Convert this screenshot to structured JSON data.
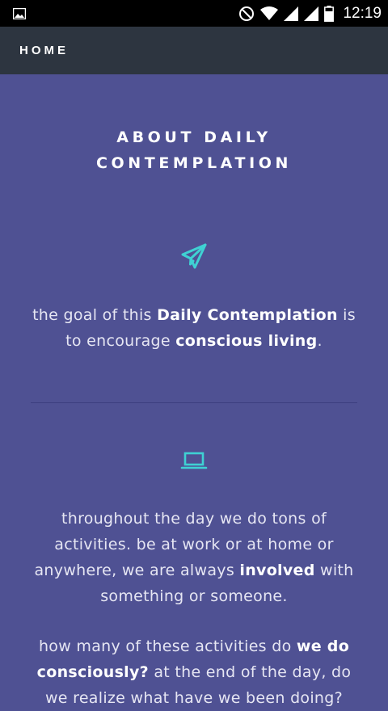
{
  "status_bar": {
    "time": "12:19",
    "icons": [
      "gallery-icon",
      "do-not-disturb-icon",
      "wifi-icon",
      "signal-icon",
      "signal-icon-2",
      "battery-icon"
    ]
  },
  "nav": {
    "home_label": "HOME"
  },
  "page": {
    "title_line1": "ABOUT DAILY",
    "title_line2": "CONTEMPLATION"
  },
  "sections": [
    {
      "icon": "paper-plane-icon",
      "p1": {
        "t1": "the goal of this ",
        "b1": "Daily Contemplation",
        "t2": " is to encourage ",
        "b2": "conscious living",
        "t3": "."
      }
    },
    {
      "icon": "laptop-icon",
      "p2": {
        "t1": "throughout the day we do tons of activities. be at work or at home or anywhere, we are always ",
        "b1": "involved",
        "t2": " with something or someone."
      },
      "p3": {
        "t1": "how many of these activities do ",
        "b1": "we do consciously?",
        "t2": " at the end of the day, do we realize what have we been doing?"
      }
    }
  ],
  "colors": {
    "background": "#4f5193",
    "nav_background": "#2d3540",
    "accent": "#3fd1d3"
  }
}
